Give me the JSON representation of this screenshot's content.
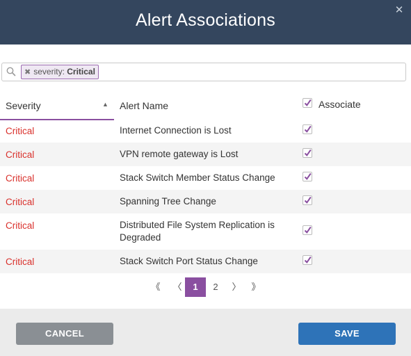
{
  "dialog": {
    "title": "Alert Associations"
  },
  "icons": {
    "close": "close-icon",
    "search": "search-icon",
    "check": "check-icon",
    "sort": "sort-ascending-icon"
  },
  "colors": {
    "header_bg": "#34465e",
    "accent": "#8a4fa0",
    "critical": "#d9302b",
    "save": "#2e73b8",
    "cancel": "#8a8f94"
  },
  "search": {
    "chips": [
      {
        "remove": "✖",
        "key": "severity:",
        "value": "Critical"
      }
    ]
  },
  "table": {
    "columns": {
      "severity": "Severity",
      "alert_name": "Alert Name",
      "associate": "Associate"
    },
    "header_associate_checked": true,
    "rows": [
      {
        "severity": "Critical",
        "name": "Internet Connection is Lost",
        "associated": true
      },
      {
        "severity": "Critical",
        "name": "VPN remote gateway is Lost",
        "associated": true
      },
      {
        "severity": "Critical",
        "name": "Stack Switch Member Status Change",
        "associated": true
      },
      {
        "severity": "Critical",
        "name": "Spanning Tree Change",
        "associated": true
      },
      {
        "severity": "Critical",
        "name": "Distributed File System Replication is Degraded",
        "associated": true
      },
      {
        "severity": "Critical",
        "name": "Stack Switch Port Status Change",
        "associated": true
      }
    ]
  },
  "pagination": {
    "first": "《",
    "prev": "〈",
    "pages": [
      "1",
      "2"
    ],
    "current": "1",
    "next": "〉",
    "last": "》"
  },
  "buttons": {
    "cancel": "CANCEL",
    "save": "SAVE"
  }
}
